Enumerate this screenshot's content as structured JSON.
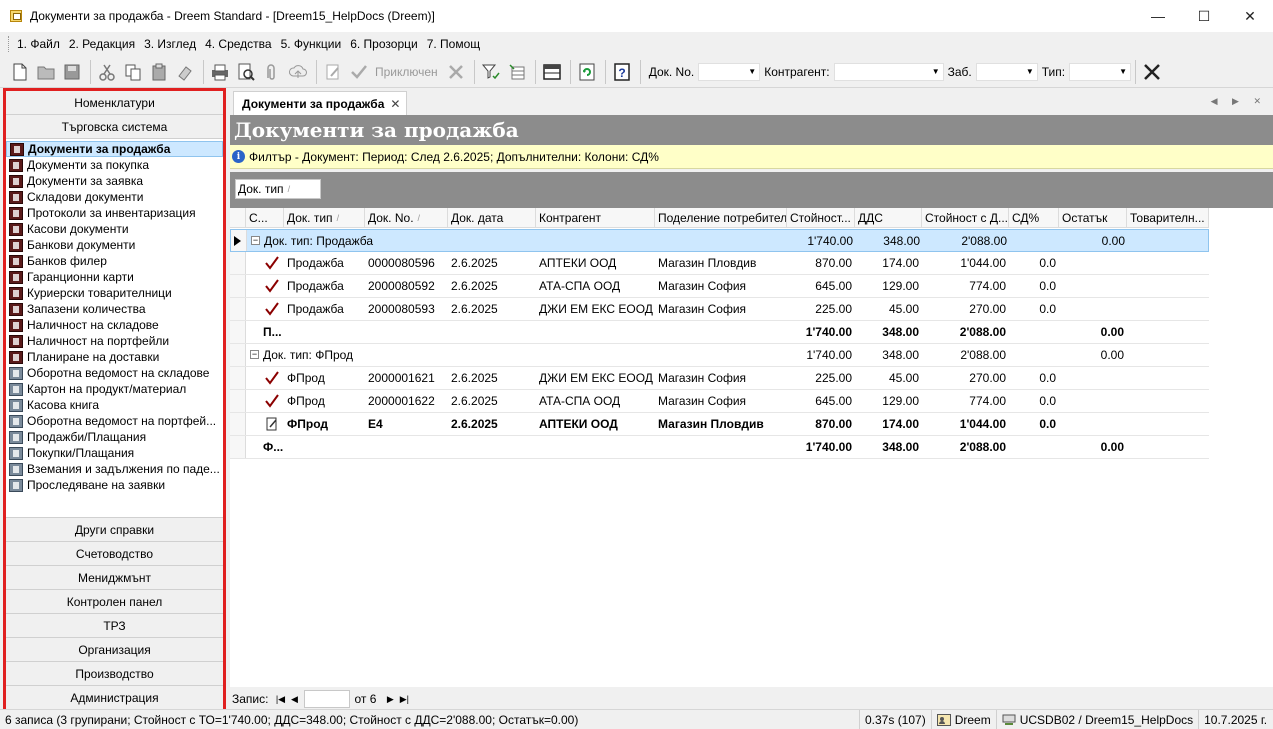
{
  "window": {
    "title": "Документи за продажба - Dreem Standard - [Dreem15_HelpDocs (Dreem)]",
    "minimize_glyph": "—",
    "maximize_glyph": "☐",
    "close_glyph": "✕"
  },
  "menu": [
    "1. Файл",
    "2. Редакция",
    "3. Изглед",
    "4. Средства",
    "5. Функции",
    "6. Прозорци",
    "7. Помощ"
  ],
  "toolbar": {
    "post_label": "Приключен",
    "doc_no_label": "Док. No.",
    "contractor_label": "Контрагент:",
    "note_label": "Заб.",
    "type_label": "Тип:",
    "icons": [
      "new-document-icon",
      "open-folder-icon",
      "save-icon",
      "cut-icon",
      "copy-icon",
      "paste-icon",
      "eraser-icon",
      "print-icon",
      "print-preview-icon",
      "attach-icon",
      "upload-icon",
      "edit-icon",
      "confirm-check-icon",
      "delete-x-icon",
      "filter-icon",
      "column-chooser-icon",
      "layout-icon",
      "refresh-icon",
      "help-icon",
      "clear-x-icon"
    ]
  },
  "sidebar": {
    "top_sections": [
      "Номенклатури",
      "Търговска система"
    ],
    "items": [
      {
        "label": "Документи за продажба",
        "selected": true,
        "icon": "book-icon"
      },
      {
        "label": "Документи за покупка",
        "icon": "book-icon"
      },
      {
        "label": "Документи за заявка",
        "icon": "book-icon"
      },
      {
        "label": "Складови документи",
        "icon": "book-icon"
      },
      {
        "label": "Протоколи за инвентаризация",
        "icon": "book-icon"
      },
      {
        "label": "Касови документи",
        "icon": "book-icon"
      },
      {
        "label": "Банкови документи",
        "icon": "book-icon"
      },
      {
        "label": "Банков филер",
        "icon": "book-icon"
      },
      {
        "label": "Гаранционни карти",
        "icon": "book-icon"
      },
      {
        "label": "Куриерски товарителници",
        "icon": "book-icon"
      },
      {
        "label": "Запазени количества",
        "icon": "book-icon"
      },
      {
        "label": "Наличност на складове",
        "icon": "book-icon"
      },
      {
        "label": "Наличност на портфейли",
        "icon": "book-icon"
      },
      {
        "label": "Планиране на доставки",
        "icon": "book-icon"
      },
      {
        "label": "Оборотна ведомост на складове",
        "icon": "report-icon"
      },
      {
        "label": "Картон на продукт/материал",
        "icon": "report-icon"
      },
      {
        "label": "Касова книга",
        "icon": "report-icon"
      },
      {
        "label": "Оборотна ведомост на портфей...",
        "icon": "report-icon"
      },
      {
        "label": "Продажби/Плащания",
        "icon": "report-icon"
      },
      {
        "label": "Покупки/Плащания",
        "icon": "report-icon"
      },
      {
        "label": "Вземания и задължения по паде...",
        "icon": "report-icon"
      },
      {
        "label": "Проследяване на заявки",
        "icon": "report-icon"
      }
    ],
    "bottom_sections": [
      "Други справки",
      "Счетоводство",
      "Мениджмънт",
      "Контролен панел",
      "ТРЗ",
      "Организация",
      "Производство",
      "Администрация"
    ]
  },
  "tab": {
    "label": "Документи за продажба",
    "close": "✕"
  },
  "header": {
    "title": "Документи за продажба"
  },
  "filter": {
    "text": "Филтър - Документ: Период: След 2.6.2025; Допълнителни: Колони: СД%"
  },
  "group_panel": {
    "chip": "Док. тип",
    "sort": "/"
  },
  "grid": {
    "columns": [
      "С...",
      "Док. тип",
      "Док. No.",
      "Док. дата",
      "Контрагент",
      "Поделение потребител",
      "Стойност...",
      "ДДС",
      "Стойност с Д...",
      "СД%",
      "Остатък",
      "Товарителн..."
    ],
    "sort_marks": [
      "",
      "/",
      "/",
      "",
      "",
      "",
      "",
      "",
      "",
      "",
      "",
      ""
    ],
    "groups": [
      {
        "label": "Док. тип: Продажба",
        "expander": "−",
        "value": "1'740.00",
        "vat": "348.00",
        "total": "2'088.00",
        "rest": "0.00",
        "rows": [
          {
            "icon": "check",
            "type": "Продажба",
            "no": "0000080596",
            "date": "2.6.2025",
            "contractor": "АПТЕКИ ООД",
            "division": "Магазин Пловдив",
            "value": "870.00",
            "vat": "174.00",
            "total": "1'044.00",
            "sd": "0.0"
          },
          {
            "icon": "check",
            "type": "Продажба",
            "no": "2000080592",
            "date": "2.6.2025",
            "contractor": "АТА-СПА ООД",
            "division": "Магазин София",
            "value": "645.00",
            "vat": "129.00",
            "total": "774.00",
            "sd": "0.0"
          },
          {
            "icon": "check",
            "type": "Продажба",
            "no": "2000080593",
            "date": "2.6.2025",
            "contractor": "ДЖИ ЕМ ЕКС ЕООД",
            "division": "Магазин София",
            "value": "225.00",
            "vat": "45.00",
            "total": "270.00",
            "sd": "0.0"
          }
        ],
        "footer": {
          "label": "П...",
          "value": "1'740.00",
          "vat": "348.00",
          "total": "2'088.00",
          "rest": "0.00"
        }
      },
      {
        "label": "Док. тип: ФПрод",
        "expander": "−",
        "value": "1'740.00",
        "vat": "348.00",
        "total": "2'088.00",
        "rest": "0.00",
        "rows": [
          {
            "icon": "check",
            "type": "ФПрод",
            "no": "2000001621",
            "date": "2.6.2025",
            "contractor": "ДЖИ ЕМ ЕКС ЕООД",
            "division": "Магазин София",
            "value": "225.00",
            "vat": "45.00",
            "total": "270.00",
            "sd": "0.0"
          },
          {
            "icon": "check",
            "type": "ФПрод",
            "no": "2000001622",
            "date": "2.6.2025",
            "contractor": "АТА-СПА ООД",
            "division": "Магазин София",
            "value": "645.00",
            "vat": "129.00",
            "total": "774.00",
            "sd": "0.0"
          },
          {
            "icon": "edit",
            "type": "ФПрод",
            "no": "Е4",
            "date": "2.6.2025",
            "contractor": "АПТЕКИ ООД",
            "division": "Магазин Пловдив",
            "value": "870.00",
            "vat": "174.00",
            "total": "1'044.00",
            "sd": "0.0",
            "bold": true
          }
        ],
        "footer": {
          "label": "Ф...",
          "value": "1'740.00",
          "vat": "348.00",
          "total": "2'088.00",
          "rest": "0.00"
        }
      }
    ]
  },
  "navigator": {
    "label": "Запис:",
    "of": "от 6",
    "value": ""
  },
  "status": {
    "summary": "6 записа (3 групирани; Стойност с ТО=1'740.00; ДДС=348.00; Стойност с ДДС=2'088.00; Остатък=0.00)",
    "timing": "0.37s (107)",
    "user": "Dreem",
    "db": "UCSDB02 / Dreem15_HelpDocs",
    "date": "10.7.2025 г."
  }
}
